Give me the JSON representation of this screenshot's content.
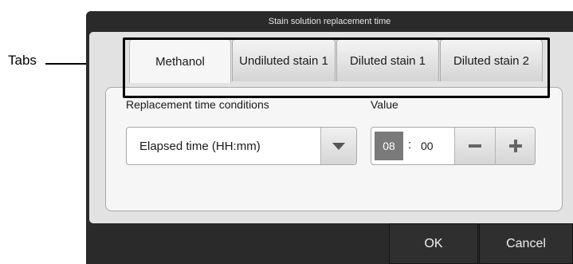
{
  "callout": {
    "label": "Tabs"
  },
  "dialog": {
    "title": "Stain solution replacement time",
    "tabs": [
      {
        "label": "Methanol",
        "active": true
      },
      {
        "label": "Undiluted stain 1",
        "active": false
      },
      {
        "label": "Diluted stain 1",
        "active": false
      },
      {
        "label": "Diluted stain 2",
        "active": false
      }
    ],
    "condition": {
      "label": "Replacement time conditions",
      "selected": "Elapsed time (HH:mm)"
    },
    "value": {
      "label": "Value",
      "hours": "08",
      "separator": ":",
      "minutes": "00"
    },
    "buttons": {
      "ok": "OK",
      "cancel": "Cancel"
    }
  }
}
